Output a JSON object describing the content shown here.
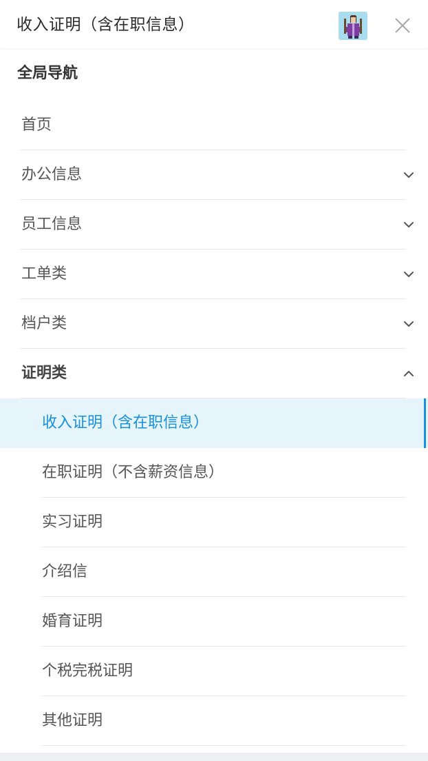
{
  "header": {
    "title": "收入证明（含在职信息）",
    "avatar_icon": "user-avatar-icon",
    "close_icon": "close-icon"
  },
  "nav": {
    "heading": "全局导航",
    "items": [
      {
        "label": "首页",
        "has_chevron": false
      },
      {
        "label": "办公信息",
        "chevron": "chevron-down-icon"
      },
      {
        "label": "员工信息",
        "chevron": "chevron-down-icon"
      },
      {
        "label": "工单类",
        "chevron": "chevron-down-icon"
      },
      {
        "label": "档户类",
        "chevron": "chevron-down-icon"
      },
      {
        "label": "证明类",
        "chevron": "chevron-up-icon",
        "expanded": true
      }
    ],
    "sub_items": [
      {
        "label": "收入证明（含在职信息）",
        "active": true
      },
      {
        "label": "在职证明（不含薪资信息）"
      },
      {
        "label": "实习证明"
      },
      {
        "label": "介绍信"
      },
      {
        "label": "婚育证明"
      },
      {
        "label": "个税完税证明"
      },
      {
        "label": "其他证明"
      }
    ]
  },
  "colors": {
    "accent": "#1890e0",
    "active_bg": "#e6f4fc",
    "avatar_bg": "#a9dcee"
  }
}
